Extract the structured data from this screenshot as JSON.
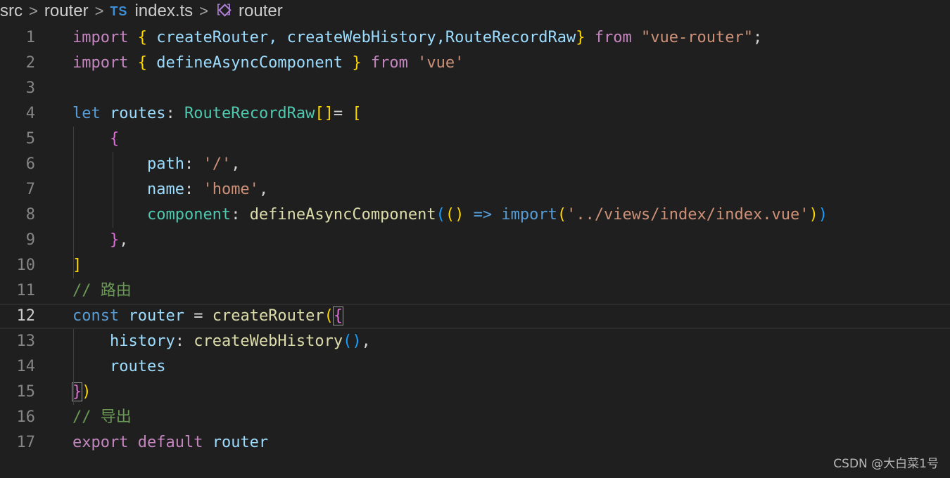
{
  "breadcrumb": {
    "items": [
      "src",
      "router",
      "index.ts",
      "router"
    ],
    "ts_badge": "TS",
    "separator": ">",
    "symbol_icon": "symbol-variable-icon"
  },
  "editor": {
    "current_line": 12,
    "colors": {
      "keyword": "#c586c0",
      "control": "#569cd6",
      "function": "#dcdcaa",
      "type": "#4ec9b0",
      "variable": "#9cdcfe",
      "string": "#ce9178",
      "comment": "#6a9955",
      "bracket_gold": "#ffd700",
      "bracket_purple": "#da70d6",
      "bracket_blue": "#179fff",
      "punct": "#d4d4d4"
    },
    "lines": [
      {
        "n": "1",
        "tokens": [
          {
            "t": "import",
            "c": "keyword"
          },
          {
            "t": " ",
            "c": "punct"
          },
          {
            "t": "{",
            "c": "bracket_gold"
          },
          {
            "t": " createRouter, createWebHistory,RouteRecordRaw",
            "c": "variable"
          },
          {
            "t": "}",
            "c": "bracket_gold"
          },
          {
            "t": " ",
            "c": "punct"
          },
          {
            "t": "from",
            "c": "keyword"
          },
          {
            "t": " ",
            "c": "punct"
          },
          {
            "t": "\"vue-router\"",
            "c": "string"
          },
          {
            "t": ";",
            "c": "punct"
          }
        ]
      },
      {
        "n": "2",
        "tokens": [
          {
            "t": "import",
            "c": "keyword"
          },
          {
            "t": " ",
            "c": "punct"
          },
          {
            "t": "{",
            "c": "bracket_gold"
          },
          {
            "t": " defineAsyncComponent ",
            "c": "variable"
          },
          {
            "t": "}",
            "c": "bracket_gold"
          },
          {
            "t": " ",
            "c": "punct"
          },
          {
            "t": "from",
            "c": "keyword"
          },
          {
            "t": " ",
            "c": "punct"
          },
          {
            "t": "'vue'",
            "c": "string"
          }
        ]
      },
      {
        "n": "3",
        "tokens": []
      },
      {
        "n": "4",
        "tokens": [
          {
            "t": "let",
            "c": "control"
          },
          {
            "t": " ",
            "c": "punct"
          },
          {
            "t": "routes",
            "c": "variable"
          },
          {
            "t": ": ",
            "c": "punct"
          },
          {
            "t": "RouteRecordRaw",
            "c": "type"
          },
          {
            "t": "[]",
            "c": "bracket_gold"
          },
          {
            "t": "= ",
            "c": "punct"
          },
          {
            "t": "[",
            "c": "bracket_gold"
          }
        ]
      },
      {
        "n": "5",
        "tokens": [
          {
            "t": "    ",
            "c": "punct"
          },
          {
            "t": "{",
            "c": "bracket_purple"
          }
        ]
      },
      {
        "n": "6",
        "tokens": [
          {
            "t": "        ",
            "c": "punct"
          },
          {
            "t": "path",
            "c": "variable"
          },
          {
            "t": ": ",
            "c": "punct"
          },
          {
            "t": "'/'",
            "c": "string"
          },
          {
            "t": ",",
            "c": "punct"
          }
        ]
      },
      {
        "n": "7",
        "tokens": [
          {
            "t": "        ",
            "c": "punct"
          },
          {
            "t": "name",
            "c": "variable"
          },
          {
            "t": ": ",
            "c": "punct"
          },
          {
            "t": "'home'",
            "c": "string"
          },
          {
            "t": ",",
            "c": "punct"
          }
        ]
      },
      {
        "n": "8",
        "tokens": [
          {
            "t": "        ",
            "c": "punct"
          },
          {
            "t": "component",
            "c": "type"
          },
          {
            "t": ": ",
            "c": "punct"
          },
          {
            "t": "defineAsyncComponent",
            "c": "function"
          },
          {
            "t": "(",
            "c": "bracket_blue"
          },
          {
            "t": "()",
            "c": "bracket_gold"
          },
          {
            "t": " ",
            "c": "punct"
          },
          {
            "t": "=>",
            "c": "control"
          },
          {
            "t": " ",
            "c": "punct"
          },
          {
            "t": "import",
            "c": "control"
          },
          {
            "t": "(",
            "c": "bracket_gold"
          },
          {
            "t": "'../views/index/index.vue'",
            "c": "string"
          },
          {
            "t": ")",
            "c": "bracket_gold"
          },
          {
            "t": ")",
            "c": "bracket_blue"
          }
        ]
      },
      {
        "n": "9",
        "tokens": [
          {
            "t": "    ",
            "c": "punct"
          },
          {
            "t": "}",
            "c": "bracket_purple"
          },
          {
            "t": ",",
            "c": "punct"
          }
        ]
      },
      {
        "n": "10",
        "tokens": [
          {
            "t": "]",
            "c": "bracket_gold"
          }
        ]
      },
      {
        "n": "11",
        "tokens": [
          {
            "t": "// 路由",
            "c": "comment"
          }
        ]
      },
      {
        "n": "12",
        "tokens": [
          {
            "t": "const",
            "c": "control"
          },
          {
            "t": " ",
            "c": "punct"
          },
          {
            "t": "router",
            "c": "variable"
          },
          {
            "t": " = ",
            "c": "punct"
          },
          {
            "t": "createRouter",
            "c": "function"
          },
          {
            "t": "(",
            "c": "bracket_gold"
          },
          {
            "t": "{",
            "c": "bracket_purple",
            "box": true
          }
        ]
      },
      {
        "n": "13",
        "tokens": [
          {
            "t": "    ",
            "c": "punct"
          },
          {
            "t": "history",
            "c": "variable"
          },
          {
            "t": ": ",
            "c": "punct"
          },
          {
            "t": "createWebHistory",
            "c": "function"
          },
          {
            "t": "()",
            "c": "bracket_blue"
          },
          {
            "t": ",",
            "c": "punct"
          }
        ]
      },
      {
        "n": "14",
        "tokens": [
          {
            "t": "    ",
            "c": "punct"
          },
          {
            "t": "routes",
            "c": "variable"
          }
        ]
      },
      {
        "n": "15",
        "tokens": [
          {
            "t": "}",
            "c": "bracket_purple",
            "box": true
          },
          {
            "t": ")",
            "c": "bracket_gold"
          }
        ]
      },
      {
        "n": "16",
        "tokens": [
          {
            "t": "// 导出",
            "c": "comment"
          }
        ]
      },
      {
        "n": "17",
        "tokens": [
          {
            "t": "export",
            "c": "keyword"
          },
          {
            "t": " ",
            "c": "punct"
          },
          {
            "t": "default",
            "c": "keyword"
          },
          {
            "t": " ",
            "c": "punct"
          },
          {
            "t": "router",
            "c": "variable"
          }
        ]
      }
    ]
  },
  "watermark": "CSDN @大白菜1号"
}
